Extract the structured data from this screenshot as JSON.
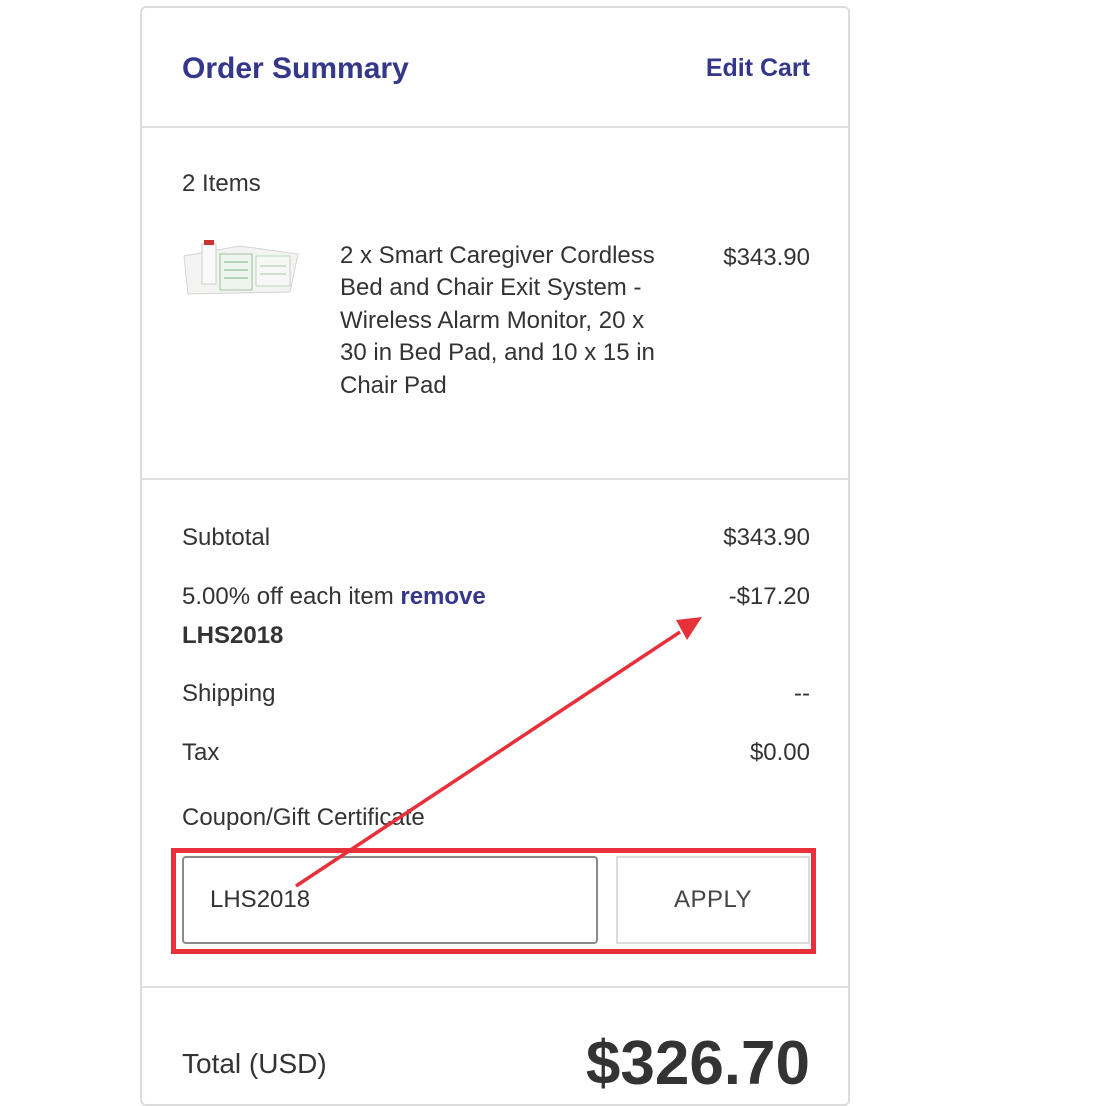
{
  "header": {
    "title": "Order Summary",
    "edit_cart": "Edit Cart"
  },
  "items": {
    "count_label": "2 Items",
    "list": [
      {
        "name": "2 x Smart Caregiver Cordless Bed and Chair Exit System - Wireless Alarm Monitor, 20 x 30 in Bed Pad, and 10 x 15 in Chair Pad",
        "price": "$343.90"
      }
    ]
  },
  "totals": {
    "subtotal_label": "Subtotal",
    "subtotal_value": "$343.90",
    "discount_label": "5.00% off each item",
    "discount_remove": "remove",
    "discount_code": "LHS2018",
    "discount_value": "-$17.20",
    "shipping_label": "Shipping",
    "shipping_value": "--",
    "tax_label": "Tax",
    "tax_value": "$0.00"
  },
  "coupon": {
    "label": "Coupon/Gift Certificate",
    "value": "LHS2018",
    "apply_label": "APPLY"
  },
  "grand_total": {
    "label": "Total (USD)",
    "value": "$326.70"
  },
  "colors": {
    "accent": "#34378a",
    "annotation": "#e8303a"
  }
}
